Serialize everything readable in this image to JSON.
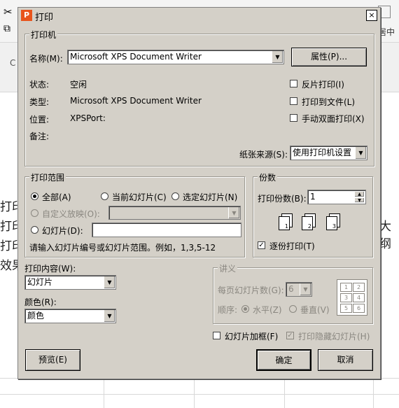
{
  "background": {
    "ribbon_right_label": "居中",
    "cell_texts": [
      "打印",
      "打印",
      "打印",
      "效果"
    ],
    "right_text": "大纲",
    "left_c": "C"
  },
  "dialog": {
    "title": "打印",
    "close_glyph": "×",
    "printer": {
      "group_title": "打印机",
      "name_label": "名称(M):",
      "name_value": "Microsoft XPS Document Writer",
      "properties_button": "属性(P)...",
      "status_label": "状态:",
      "status_value": "空闲",
      "type_label": "类型:",
      "type_value": "Microsoft XPS Document Writer",
      "location_label": "位置:",
      "location_value": "XPSPort:",
      "comment_label": "备注:",
      "reverse_print": "反片打印(I)",
      "print_to_file": "打印到文件(L)",
      "manual_duplex": "手动双面打印(X)",
      "paper_source_label": "纸张来源(S):",
      "paper_source_value": "使用打印机设置"
    },
    "range": {
      "group_title": "打印范围",
      "all": "全部(A)",
      "current": "当前幻灯片(C)",
      "selected": "选定幻灯片(N)",
      "custom_show": "自定义放映(O):",
      "slides": "幻灯片(D):",
      "hint": "请输入幻灯片编号或幻灯片范围。例如，1,3,5-12"
    },
    "copies": {
      "group_title": "份数",
      "count_label": "打印份数(B):",
      "count_value": "1",
      "collate": "逐份打印(T)",
      "page_numbers": [
        "1",
        "2",
        "3"
      ]
    },
    "content": {
      "label": "打印内容(W):",
      "value": "幻灯片",
      "color_label": "颜色(R):",
      "color_value": "颜色"
    },
    "handouts": {
      "group_title": "讲义",
      "per_page_label": "每页幻灯片数(G):",
      "per_page_value": "6",
      "order_label": "顺序:",
      "horizontal": "水平(Z)",
      "vertical": "垂直(V)",
      "preview_numbers": [
        "1",
        "2",
        "3",
        "4",
        "5",
        "6"
      ]
    },
    "frame_slides": "幻灯片加框(F)",
    "print_hidden": "打印隐藏幻灯片(H)",
    "preview_button": "预览(E)",
    "ok_button": "确定",
    "cancel_button": "取消"
  }
}
